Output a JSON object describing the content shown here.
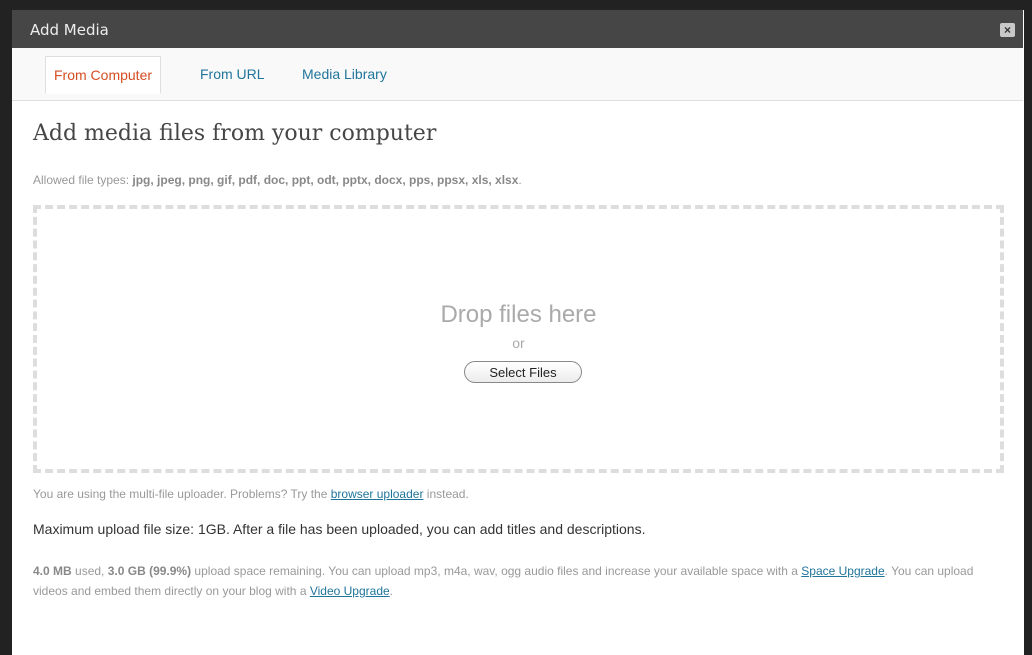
{
  "dialog": {
    "title": "Add Media",
    "close_label": "×"
  },
  "tabs": [
    {
      "label": "From Computer",
      "active": true
    },
    {
      "label": "From URL",
      "active": false
    },
    {
      "label": "Media Library",
      "active": false
    }
  ],
  "main": {
    "heading": "Add media files from your computer",
    "allowed_prefix": "Allowed file types: ",
    "allowed_types": "jpg, jpeg, png, gif, pdf, doc, ppt, odt, pptx, docx, pps, ppsx, xls, xlsx",
    "allowed_suffix": ".",
    "drop_text": "Drop files here",
    "or_text": "or",
    "select_button": "Select Files",
    "multi_prefix": "You are using the multi-file uploader. Problems? Try the ",
    "multi_link": "browser uploader",
    "multi_suffix": " instead.",
    "max_upload": "Maximum upload file size: 1GB. After a file has been uploaded, you can add titles and descriptions.",
    "space_used": "4.0 MB",
    "space_text_1": " used, ",
    "space_remaining": "3.0 GB (99.9%)",
    "space_text_2": " upload space remaining. You can upload mp3, m4a, wav, ogg audio files and increase your available space with a ",
    "space_upgrade_link": "Space Upgrade",
    "space_text_3": ". You can upload videos and embed them directly on your blog with a ",
    "video_upgrade_link": "Video Upgrade",
    "space_text_4": "."
  },
  "colors": {
    "title_bar": "#464646",
    "active_tab_text": "#d54e21",
    "link": "#21759b"
  }
}
